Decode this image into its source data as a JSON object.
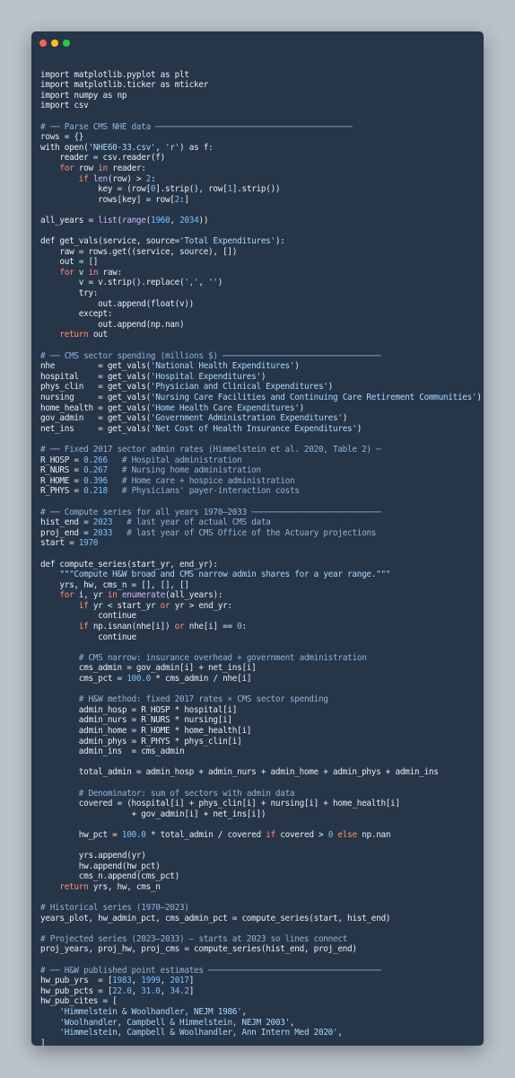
{
  "window": {
    "controls": [
      "close",
      "minimize",
      "maximize"
    ],
    "colors": {
      "background": "#263547",
      "close": "#ff5f56",
      "minimize": "#ffbd2e",
      "maximize": "#27c93f"
    }
  },
  "lines": [
    [],
    [
      [
        "t",
        "import matplotlib.pyplot as plt"
      ]
    ],
    [
      [
        "t",
        "import matplotlib.ticker as mticker"
      ]
    ],
    [
      [
        "t",
        "import numpy as np"
      ]
    ],
    [
      [
        "t",
        "import csv"
      ]
    ],
    [],
    [
      [
        "cm",
        "# ── Parse CMS NHE data ─────────────────────────────────────────"
      ]
    ],
    [
      [
        "t",
        "rows = {}"
      ]
    ],
    [
      [
        "t",
        "with open("
      ],
      [
        "st",
        "'NHE60-33.csv'"
      ],
      [
        "t",
        ", "
      ],
      [
        "st",
        "'r'"
      ],
      [
        "t",
        ") as f:"
      ]
    ],
    [
      [
        "t",
        "    reader = csv.reader(f)"
      ]
    ],
    [
      [
        "t",
        "    "
      ],
      [
        "kw",
        "for"
      ],
      [
        "t",
        " row "
      ],
      [
        "kw",
        "in"
      ],
      [
        "t",
        " reader:"
      ]
    ],
    [
      [
        "t",
        "        "
      ],
      [
        "kw",
        "if"
      ],
      [
        "t",
        " "
      ],
      [
        "bi",
        "len"
      ],
      [
        "t",
        "(row) > "
      ],
      [
        "nu",
        "2"
      ],
      [
        "t",
        ":"
      ]
    ],
    [
      [
        "t",
        "            key = (row["
      ],
      [
        "nu",
        "0"
      ],
      [
        "t",
        "].strip(), row["
      ],
      [
        "nu",
        "1"
      ],
      [
        "t",
        "].strip())"
      ]
    ],
    [
      [
        "t",
        "            rows[key] = row["
      ],
      [
        "nu",
        "2"
      ],
      [
        "t",
        ":]"
      ]
    ],
    [],
    [
      [
        "t",
        "all_years = "
      ],
      [
        "bi",
        "list"
      ],
      [
        "t",
        "("
      ],
      [
        "bi",
        "range"
      ],
      [
        "t",
        "("
      ],
      [
        "nu",
        "1960"
      ],
      [
        "t",
        ", "
      ],
      [
        "nu",
        "2034"
      ],
      [
        "t",
        "))"
      ]
    ],
    [],
    [
      [
        "t",
        "def get_vals(service, source="
      ],
      [
        "st",
        "'Total Expenditures'"
      ],
      [
        "t",
        "):"
      ]
    ],
    [
      [
        "t",
        "    raw = rows.get((service, source), [])"
      ]
    ],
    [
      [
        "t",
        "    out = []"
      ]
    ],
    [
      [
        "t",
        "    "
      ],
      [
        "kw",
        "for"
      ],
      [
        "t",
        " v "
      ],
      [
        "kw",
        "in"
      ],
      [
        "t",
        " raw:"
      ]
    ],
    [
      [
        "t",
        "        v = v.strip().replace("
      ],
      [
        "st",
        "','"
      ],
      [
        "t",
        ", "
      ],
      [
        "st",
        "''"
      ],
      [
        "t",
        ")"
      ]
    ],
    [
      [
        "t",
        "        try:"
      ]
    ],
    [
      [
        "t",
        "            out.append(float(v))"
      ]
    ],
    [
      [
        "t",
        "        except:"
      ]
    ],
    [
      [
        "t",
        "            out.append(np.nan)"
      ]
    ],
    [
      [
        "t",
        "    "
      ],
      [
        "kw",
        "return"
      ],
      [
        "t",
        " out"
      ]
    ],
    [],
    [
      [
        "cm",
        "# ── CMS sector spending (millions $) ─────────────────────────────────"
      ]
    ],
    [
      [
        "t",
        "nhe         = get_vals("
      ],
      [
        "st",
        "'National Health Expenditures'"
      ],
      [
        "t",
        ")"
      ]
    ],
    [
      [
        "t",
        "hospital    = get_vals("
      ],
      [
        "st",
        "'Hospital Expenditures'"
      ],
      [
        "t",
        ")"
      ]
    ],
    [
      [
        "t",
        "phys_clin   = get_vals("
      ],
      [
        "st",
        "'Physician and Clinical Expenditures'"
      ],
      [
        "t",
        ")"
      ]
    ],
    [
      [
        "t",
        "nursing     = get_vals("
      ],
      [
        "st",
        "'Nursing Care Facilities and Continuing Care Retirement Communities'"
      ],
      [
        "t",
        ")"
      ]
    ],
    [
      [
        "t",
        "home_health = get_vals("
      ],
      [
        "st",
        "'Home Health Care Expenditures'"
      ],
      [
        "t",
        ")"
      ]
    ],
    [
      [
        "t",
        "gov_admin   = get_vals("
      ],
      [
        "st",
        "'Government Administration Expenditures'"
      ],
      [
        "t",
        ")"
      ]
    ],
    [
      [
        "t",
        "net_ins     = get_vals("
      ],
      [
        "st",
        "'Net Cost of Health Insurance Expenditures'"
      ],
      [
        "t",
        ")"
      ]
    ],
    [],
    [
      [
        "cm",
        "# ── Fixed 2017 sector admin rates (Himmelstein et al. 2020, Table 2) ─"
      ]
    ],
    [
      [
        "t",
        "R_HOSP = "
      ],
      [
        "nu",
        "0.266"
      ],
      [
        "t",
        "   "
      ],
      [
        "cm",
        "# Hospital administration"
      ]
    ],
    [
      [
        "t",
        "R_NURS = "
      ],
      [
        "nu",
        "0.267"
      ],
      [
        "t",
        "   "
      ],
      [
        "cm",
        "# Nursing home administration"
      ]
    ],
    [
      [
        "t",
        "R_HOME = "
      ],
      [
        "nu",
        "0.396"
      ],
      [
        "t",
        "   "
      ],
      [
        "cm",
        "# Home care + hospice administration"
      ]
    ],
    [
      [
        "t",
        "R_PHYS = "
      ],
      [
        "nu",
        "0.218"
      ],
      [
        "t",
        "   "
      ],
      [
        "cm",
        "# Physicians' payer-interaction costs"
      ]
    ],
    [],
    [
      [
        "cm",
        "# ── Compute series for all years 1970–2033 ───────────────────────────"
      ]
    ],
    [
      [
        "t",
        "hist_end = "
      ],
      [
        "nu",
        "2023"
      ],
      [
        "t",
        "   "
      ],
      [
        "cm",
        "# last year of actual CMS data"
      ]
    ],
    [
      [
        "t",
        "proj_end = "
      ],
      [
        "nu",
        "2033"
      ],
      [
        "t",
        "   "
      ],
      [
        "cm",
        "# last year of CMS Office of the Actuary projections"
      ]
    ],
    [
      [
        "t",
        "start = "
      ],
      [
        "nu",
        "1970"
      ]
    ],
    [],
    [
      [
        "t",
        "def compute_series(start_yr, end_yr):"
      ]
    ],
    [
      [
        "t",
        "    "
      ],
      [
        "st",
        "\"\"\"Compute H&W broad and CMS narrow admin shares for a year range.\"\"\""
      ]
    ],
    [
      [
        "t",
        "    yrs, hw, cms_n = [], [], []"
      ]
    ],
    [
      [
        "t",
        "    "
      ],
      [
        "kw",
        "for"
      ],
      [
        "t",
        " i, yr "
      ],
      [
        "kw",
        "in"
      ],
      [
        "t",
        " "
      ],
      [
        "bi",
        "enumerate"
      ],
      [
        "t",
        "(all_years):"
      ]
    ],
    [
      [
        "t",
        "        "
      ],
      [
        "kw",
        "if"
      ],
      [
        "t",
        " yr < start_yr "
      ],
      [
        "kw",
        "or"
      ],
      [
        "t",
        " yr > end_yr:"
      ]
    ],
    [
      [
        "t",
        "            continue"
      ]
    ],
    [
      [
        "t",
        "        "
      ],
      [
        "kw",
        "if"
      ],
      [
        "t",
        " np.isnan(nhe[i]) "
      ],
      [
        "kw",
        "or"
      ],
      [
        "t",
        " nhe[i] == "
      ],
      [
        "nu",
        "0"
      ],
      [
        "t",
        ":"
      ]
    ],
    [
      [
        "t",
        "            continue"
      ]
    ],
    [],
    [
      [
        "t",
        "        "
      ],
      [
        "cm",
        "# CMS narrow: insurance overhead + government administration"
      ]
    ],
    [
      [
        "t",
        "        cms_admin = gov_admin[i] + net_ins[i]"
      ]
    ],
    [
      [
        "t",
        "        cms_pct = "
      ],
      [
        "nu",
        "100.0"
      ],
      [
        "t",
        " * cms_admin / nhe[i]"
      ]
    ],
    [],
    [
      [
        "t",
        "        "
      ],
      [
        "cm",
        "# H&W method: fixed 2017 rates × CMS sector spending"
      ]
    ],
    [
      [
        "t",
        "        admin_hosp = R_HOSP * hospital[i]"
      ]
    ],
    [
      [
        "t",
        "        admin_nurs = R_NURS * nursing[i]"
      ]
    ],
    [
      [
        "t",
        "        admin_home = R_HOME * home_health[i]"
      ]
    ],
    [
      [
        "t",
        "        admin_phys = R_PHYS * phys_clin[i]"
      ]
    ],
    [
      [
        "t",
        "        admin_ins  = cms_admin"
      ]
    ],
    [],
    [
      [
        "t",
        "        total_admin = admin_hosp + admin_nurs + admin_home + admin_phys + admin_ins"
      ]
    ],
    [],
    [
      [
        "t",
        "        "
      ],
      [
        "cm",
        "# Denominator: sum of sectors with admin data"
      ]
    ],
    [
      [
        "t",
        "        covered = (hospital[i] + phys_clin[i] + nursing[i] + home_health[i]"
      ]
    ],
    [
      [
        "t",
        "                   + gov_admin[i] + net_ins[i])"
      ]
    ],
    [],
    [
      [
        "t",
        "        hw_pct = "
      ],
      [
        "nu",
        "100.0"
      ],
      [
        "t",
        " * total_admin / covered "
      ],
      [
        "kw",
        "if"
      ],
      [
        "t",
        " covered > "
      ],
      [
        "nu",
        "0"
      ],
      [
        "t",
        " "
      ],
      [
        "kw",
        "else"
      ],
      [
        "t",
        " np.nan"
      ]
    ],
    [],
    [
      [
        "t",
        "        yrs.append(yr)"
      ]
    ],
    [
      [
        "t",
        "        hw.append(hw_pct)"
      ]
    ],
    [
      [
        "t",
        "        cms_n.append(cms_pct)"
      ]
    ],
    [
      [
        "t",
        "    "
      ],
      [
        "kw",
        "return"
      ],
      [
        "t",
        " yrs, hw, cms_n"
      ]
    ],
    [],
    [
      [
        "cm",
        "# Historical series (1970–2023)"
      ]
    ],
    [
      [
        "t",
        "years_plot, hw_admin_pct, cms_admin_pct = compute_series(start, hist_end)"
      ]
    ],
    [],
    [
      [
        "cm",
        "# Projected series (2023–2033) — starts at 2023 so lines connect"
      ]
    ],
    [
      [
        "t",
        "proj_years, proj_hw, proj_cms = compute_series(hist_end, proj_end)"
      ]
    ],
    [],
    [
      [
        "cm",
        "# ── H&W published point estimates ────────────────────────────────────"
      ]
    ],
    [
      [
        "t",
        "hw_pub_yrs  = ["
      ],
      [
        "nu",
        "1983"
      ],
      [
        "t",
        ", "
      ],
      [
        "nu",
        "1999"
      ],
      [
        "t",
        ", "
      ],
      [
        "nu",
        "2017"
      ],
      [
        "t",
        "]"
      ]
    ],
    [
      [
        "t",
        "hw_pub_pcts = ["
      ],
      [
        "nu",
        "22.0"
      ],
      [
        "t",
        ", "
      ],
      [
        "nu",
        "31.0"
      ],
      [
        "t",
        ", "
      ],
      [
        "nu",
        "34.2"
      ],
      [
        "t",
        "]"
      ]
    ],
    [
      [
        "t",
        "hw_pub_cites = ["
      ]
    ],
    [
      [
        "t",
        "    "
      ],
      [
        "st",
        "'Himmelstein & Woolhandler, NEJM 1986'"
      ],
      [
        "t",
        ","
      ]
    ],
    [
      [
        "t",
        "    "
      ],
      [
        "st",
        "'Woolhandler, Campbell & Himmelstein, NEJM 2003'"
      ],
      [
        "t",
        ","
      ]
    ],
    [
      [
        "t",
        "    "
      ],
      [
        "st",
        "'Himmelstein, Campbell & Woolhandler, Ann Intern Med 2020'"
      ],
      [
        "t",
        ","
      ]
    ],
    [
      [
        "t",
        "]"
      ]
    ]
  ]
}
